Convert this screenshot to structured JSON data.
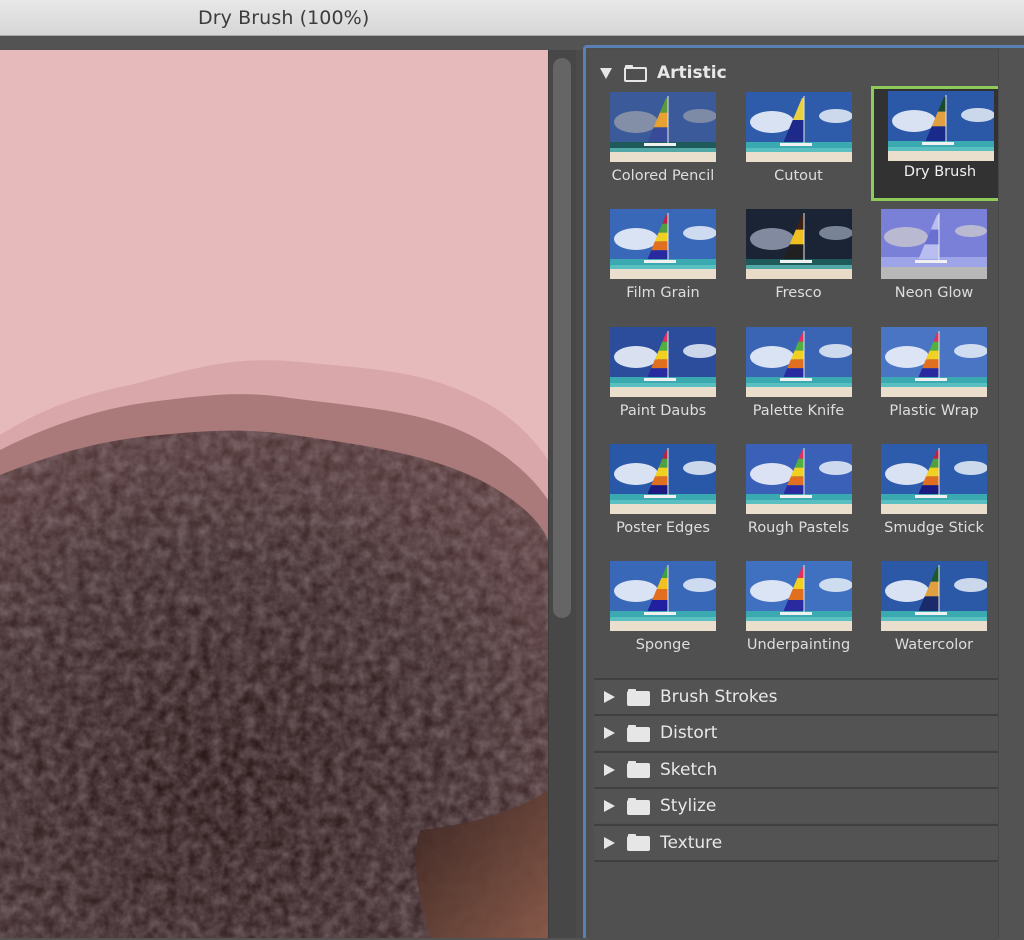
{
  "window": {
    "title": "Dry Brush (100%)"
  },
  "gallery": {
    "open_category": {
      "label": "Artistic",
      "filters": [
        {
          "label": "Colored Pencil",
          "selected": false,
          "thumb": "colored-pencil"
        },
        {
          "label": "Cutout",
          "selected": false,
          "thumb": "cutout"
        },
        {
          "label": "Dry Brush",
          "selected": true,
          "thumb": "dry-brush"
        },
        {
          "label": "Film Grain",
          "selected": false,
          "thumb": "film-grain"
        },
        {
          "label": "Fresco",
          "selected": false,
          "thumb": "fresco"
        },
        {
          "label": "Neon Glow",
          "selected": false,
          "thumb": "neon-glow"
        },
        {
          "label": "Paint Daubs",
          "selected": false,
          "thumb": "paint-daubs"
        },
        {
          "label": "Palette Knife",
          "selected": false,
          "thumb": "palette-knife"
        },
        {
          "label": "Plastic Wrap",
          "selected": false,
          "thumb": "plastic-wrap"
        },
        {
          "label": "Poster Edges",
          "selected": false,
          "thumb": "poster-edges"
        },
        {
          "label": "Rough Pastels",
          "selected": false,
          "thumb": "rough-pastels"
        },
        {
          "label": "Smudge Stick",
          "selected": false,
          "thumb": "smudge-stick"
        },
        {
          "label": "Sponge",
          "selected": false,
          "thumb": "sponge"
        },
        {
          "label": "Underpainting",
          "selected": false,
          "thumb": "underpainting"
        },
        {
          "label": "Watercolor",
          "selected": false,
          "thumb": "watercolor"
        }
      ]
    },
    "collapsed_categories": [
      {
        "label": "Brush Strokes"
      },
      {
        "label": "Distort"
      },
      {
        "label": "Sketch"
      },
      {
        "label": "Stylize"
      },
      {
        "label": "Texture"
      }
    ]
  },
  "colors": {
    "selection_border": "#8fcb5b",
    "panel_focus": "#5a7fb5",
    "preview_background": "#e6b9bb"
  }
}
